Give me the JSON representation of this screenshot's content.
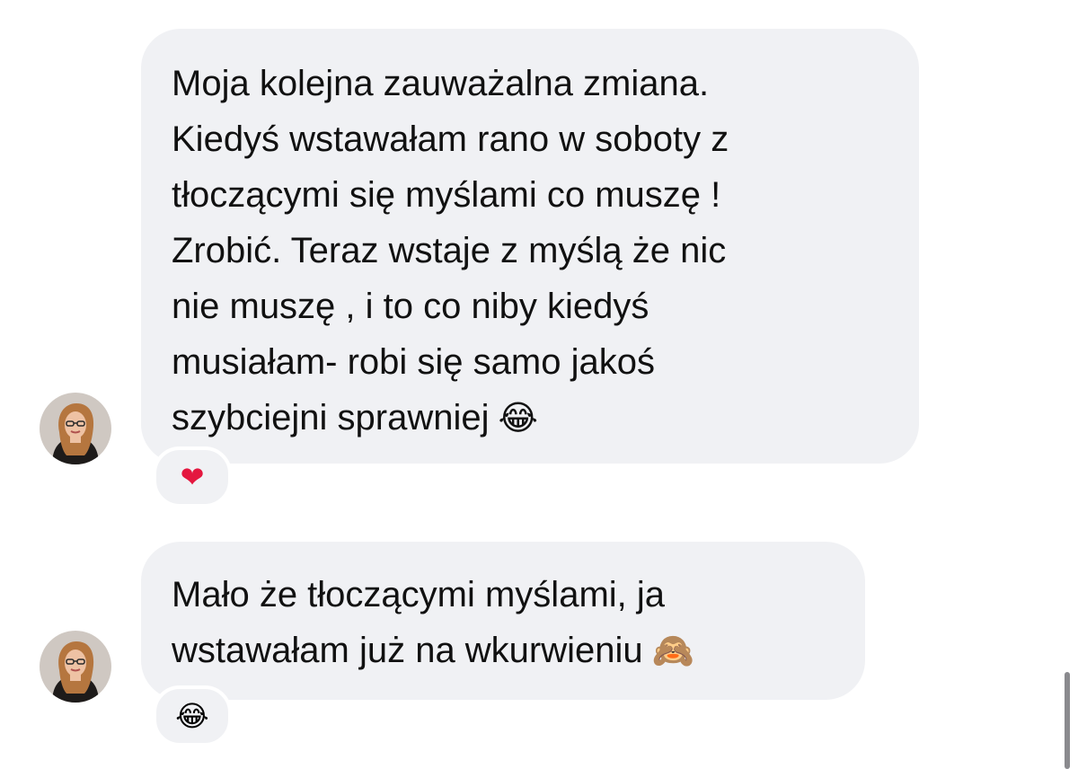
{
  "messages": [
    {
      "lines": [
        "Moja kolejna zauważalna zmiana.",
        "Kiedyś wstawałam rano w soboty z",
        "tłoczącymi się myślami co muszę !",
        "Zrobić.  Teraz wstaje z myślą że nic",
        "nie muszę , i to co niby kiedyś",
        "musiałam- robi się samo jakoś",
        "szybciejni sprawniej"
      ],
      "trailing_emoji": "😂",
      "reaction": "❤"
    },
    {
      "lines": [
        "Mało że tłoczącymi myślami, ja",
        "wstawałam już na wkurwieniu"
      ],
      "trailing_emoji": "🙈",
      "reaction": "😂"
    }
  ],
  "colors": {
    "bubble": "#f0f1f4",
    "text": "#111111",
    "heart": "#e4173f"
  },
  "icons": {
    "avatar": "user-photo",
    "reaction_1": "heart-icon",
    "reaction_2": "laughing-emoji-icon"
  }
}
